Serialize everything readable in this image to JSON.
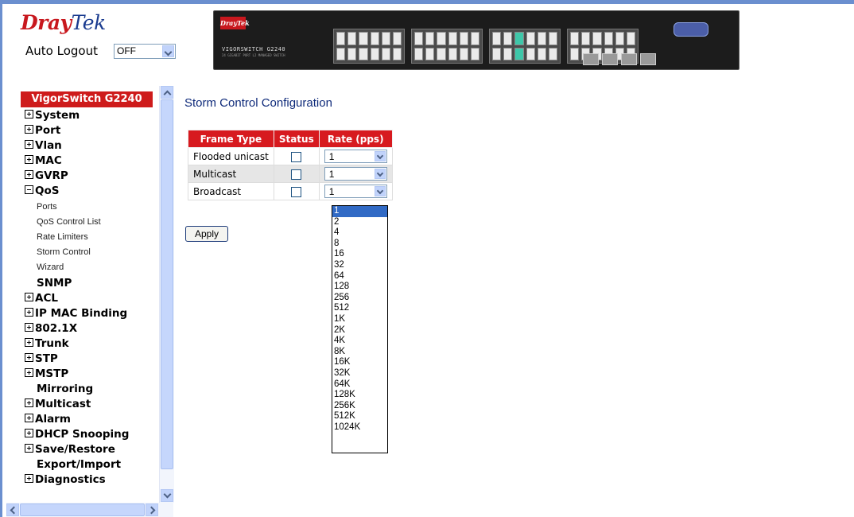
{
  "header": {
    "logo_dray": "Dray",
    "logo_tek": "Tek",
    "auto_logout_label": "Auto Logout",
    "auto_logout_value": "OFF"
  },
  "device": {
    "brand": "DrayTek",
    "model": "VIGORSWITCH G2240",
    "submodel": "24 GIGABIT PORT L2 MANAGED SWITCH"
  },
  "sidebar": {
    "title": "VigorSwitch G2240",
    "items": [
      {
        "label": "System",
        "icon": "plus"
      },
      {
        "label": "Port",
        "icon": "plus"
      },
      {
        "label": "Vlan",
        "icon": "plus"
      },
      {
        "label": "MAC",
        "icon": "plus"
      },
      {
        "label": "GVRP",
        "icon": "plus"
      },
      {
        "label": "QoS",
        "icon": "minus"
      },
      {
        "label": "SNMP",
        "icon": "none"
      },
      {
        "label": "ACL",
        "icon": "plus"
      },
      {
        "label": "IP MAC Binding",
        "icon": "plus"
      },
      {
        "label": "802.1X",
        "icon": "plus"
      },
      {
        "label": "Trunk",
        "icon": "plus"
      },
      {
        "label": "STP",
        "icon": "plus"
      },
      {
        "label": "MSTP",
        "icon": "plus"
      },
      {
        "label": "Mirroring",
        "icon": "none"
      },
      {
        "label": "Multicast",
        "icon": "plus"
      },
      {
        "label": "Alarm",
        "icon": "plus"
      },
      {
        "label": "DHCP Snooping",
        "icon": "plus"
      },
      {
        "label": "Save/Restore",
        "icon": "plus"
      },
      {
        "label": "Export/Import",
        "icon": "none"
      },
      {
        "label": "Diagnostics",
        "icon": "plus"
      }
    ],
    "qos_subitems": [
      "Ports",
      "QoS Control List",
      "Rate Limiters",
      "Storm Control",
      "Wizard"
    ]
  },
  "main": {
    "title": "Storm Control Configuration",
    "table": {
      "headers": [
        "Frame Type",
        "Status",
        "Rate (pps)"
      ],
      "rows": [
        {
          "frame_type": "Flooded unicast",
          "status": false,
          "rate": "1"
        },
        {
          "frame_type": "Multicast",
          "status": false,
          "rate": "1"
        },
        {
          "frame_type": "Broadcast",
          "status": false,
          "rate": "1"
        }
      ]
    },
    "apply_label": "Apply",
    "rate_options": [
      "1",
      "2",
      "4",
      "8",
      "16",
      "32",
      "64",
      "128",
      "256",
      "512",
      "1K",
      "2K",
      "4K",
      "8K",
      "16K",
      "32K",
      "64K",
      "128K",
      "256K",
      "512K",
      "1024K"
    ],
    "rate_selected": "1"
  },
  "colors": {
    "accent_red": "#d71a1f",
    "title_blue": "#0e2a7a",
    "selection_blue": "#316ac5"
  }
}
